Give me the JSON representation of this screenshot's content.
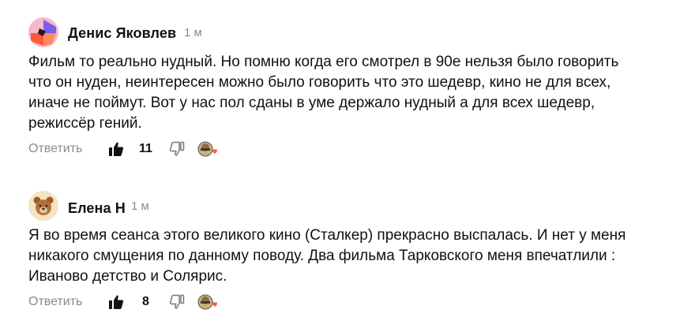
{
  "comments": [
    {
      "author": "Денис Яковлев",
      "time": "1 м",
      "text_lines": [
        "Фильм то реально нудный. Но помню когда его смотрел в 90е нельзя было говорить",
        "что он нуден, неинтересен можно было говорить что это шедевр, кино не для всех,",
        "иначе не поймут. Вот у нас пол сданы в уме держало нудный а для всех шедевр,",
        "режиссёр гений."
      ],
      "reply_label": "Ответить",
      "likes": "11",
      "avatar_icon": "abstract-avatar-icon"
    },
    {
      "author": "Елена Н",
      "time": "1 м",
      "text_lines": [
        "Я во время сеанса этого великого кино (Сталкер) прекрасно выспалась. И нет у меня",
        "никакого смущения по данному поводу. Два фильма Тарковского меня впечатлили :",
        "Иваново детство и Солярис."
      ],
      "reply_label": "Ответить",
      "likes": "8",
      "avatar_icon": "bear-avatar-icon"
    }
  ],
  "colors": {
    "text": "#111111",
    "muted": "#8a8a8a",
    "heart": "#ff5a36"
  }
}
